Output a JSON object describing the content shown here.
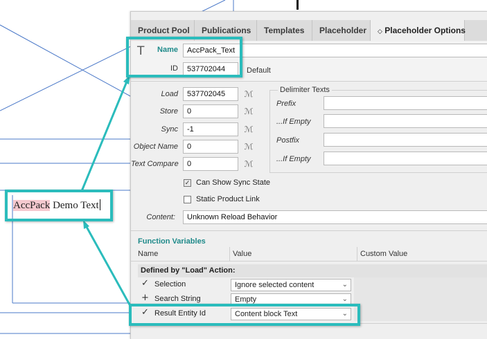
{
  "tabs": [
    "Product Pool",
    "Publications",
    "Templates",
    "Placeholder",
    "Placeholder Options"
  ],
  "active_tab_index": 4,
  "tab_active_icon": "chevron-updown-icon",
  "placeholder": {
    "name_label": "Name",
    "name_value": "AccPack_Text",
    "id_label": "ID",
    "id_value": "537702044",
    "default_text": "Default"
  },
  "actions": {
    "load_label": "Load",
    "load_value": "537702045",
    "store_label": "Store",
    "store_value": "0",
    "sync_label": "Sync",
    "sync_value": "-1",
    "object_name_label": "Object Name",
    "object_name_value": "0",
    "text_compare_label": "Text Compare",
    "text_compare_value": "0"
  },
  "delimiter": {
    "title": "Delimiter Texts",
    "prefix_label": "Prefix",
    "if_empty_label": "...If Empty",
    "postfix_label": "Postfix",
    "if_empty2_label": "...If Empty",
    "prefix_value": "",
    "if_empty_value": "",
    "postfix_value": "",
    "if_empty2_value": ""
  },
  "options": {
    "can_show_sync_label": "Can Show Sync State",
    "can_show_sync_checked": true,
    "static_link_label": "Static Product Link",
    "static_link_checked": false,
    "content_label": "Content:",
    "content_value": "Unknown Reload Behavior"
  },
  "function_variables": {
    "title": "Function Variables",
    "columns": [
      "Name",
      "Value",
      "Custom Value"
    ],
    "group_label": "Defined by \"Load\" Action:",
    "rows": [
      {
        "mark": "✓",
        "name": "Selection",
        "value": "Ignore selected content"
      },
      {
        "mark": "+",
        "name": "Search String",
        "value": "Empty"
      },
      {
        "mark": "✓",
        "name": "Result Entity Id",
        "value": "Content block Text"
      }
    ]
  },
  "document": {
    "text_highlighted": "AccPack",
    "text_rest": " Demo Text"
  },
  "colors": {
    "highlight": "#2bbcbc",
    "accent_teal": "#1f8a8a",
    "guide_blue": "#4a78c8",
    "text_highlight": "#f6c9cf"
  }
}
